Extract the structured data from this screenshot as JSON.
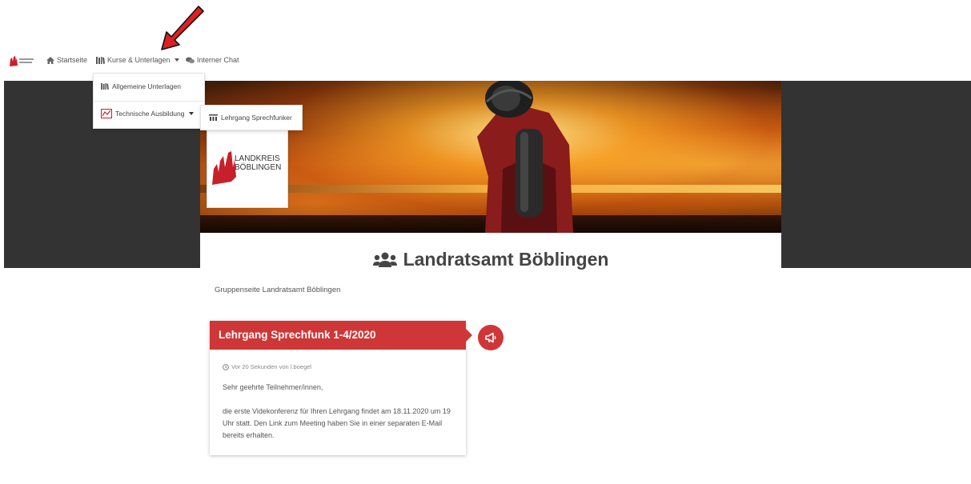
{
  "nav": {
    "home_label": "Startseite",
    "courses_label": "Kurse & Unterlagen",
    "chat_label": "Interner Chat"
  },
  "dropdown": {
    "items": [
      {
        "label": "Allgemeine Unterlagen",
        "icon": "books-icon"
      },
      {
        "label": "Technische Ausbildung",
        "icon": "training-icon"
      }
    ],
    "submenu": {
      "label": "Lehrgang Sprechfunker",
      "icon": "group-icon"
    }
  },
  "logo": {
    "line1": "LANDKREIS",
    "line2": "BÖBLINGEN"
  },
  "page": {
    "title": "Landratsamt Böblingen",
    "description": "Gruppenseite Landratsamt Böblingen"
  },
  "post": {
    "title": "Lehrgang Sprechfunk 1-4/2020",
    "meta": "Vor 20 Sekunden von l.boegel",
    "greeting": "Sehr geehrte Teilnehmer/innen,",
    "body": "die erste Videkonferenz für Ihren Lehrgang findet am 18.11.2020 um 19 Uhr statt. Den Link zum Meeting haben Sie in einer separaten E-Mail bereits erhalten."
  },
  "colors": {
    "accent": "#cf3637",
    "band": "#333333"
  }
}
